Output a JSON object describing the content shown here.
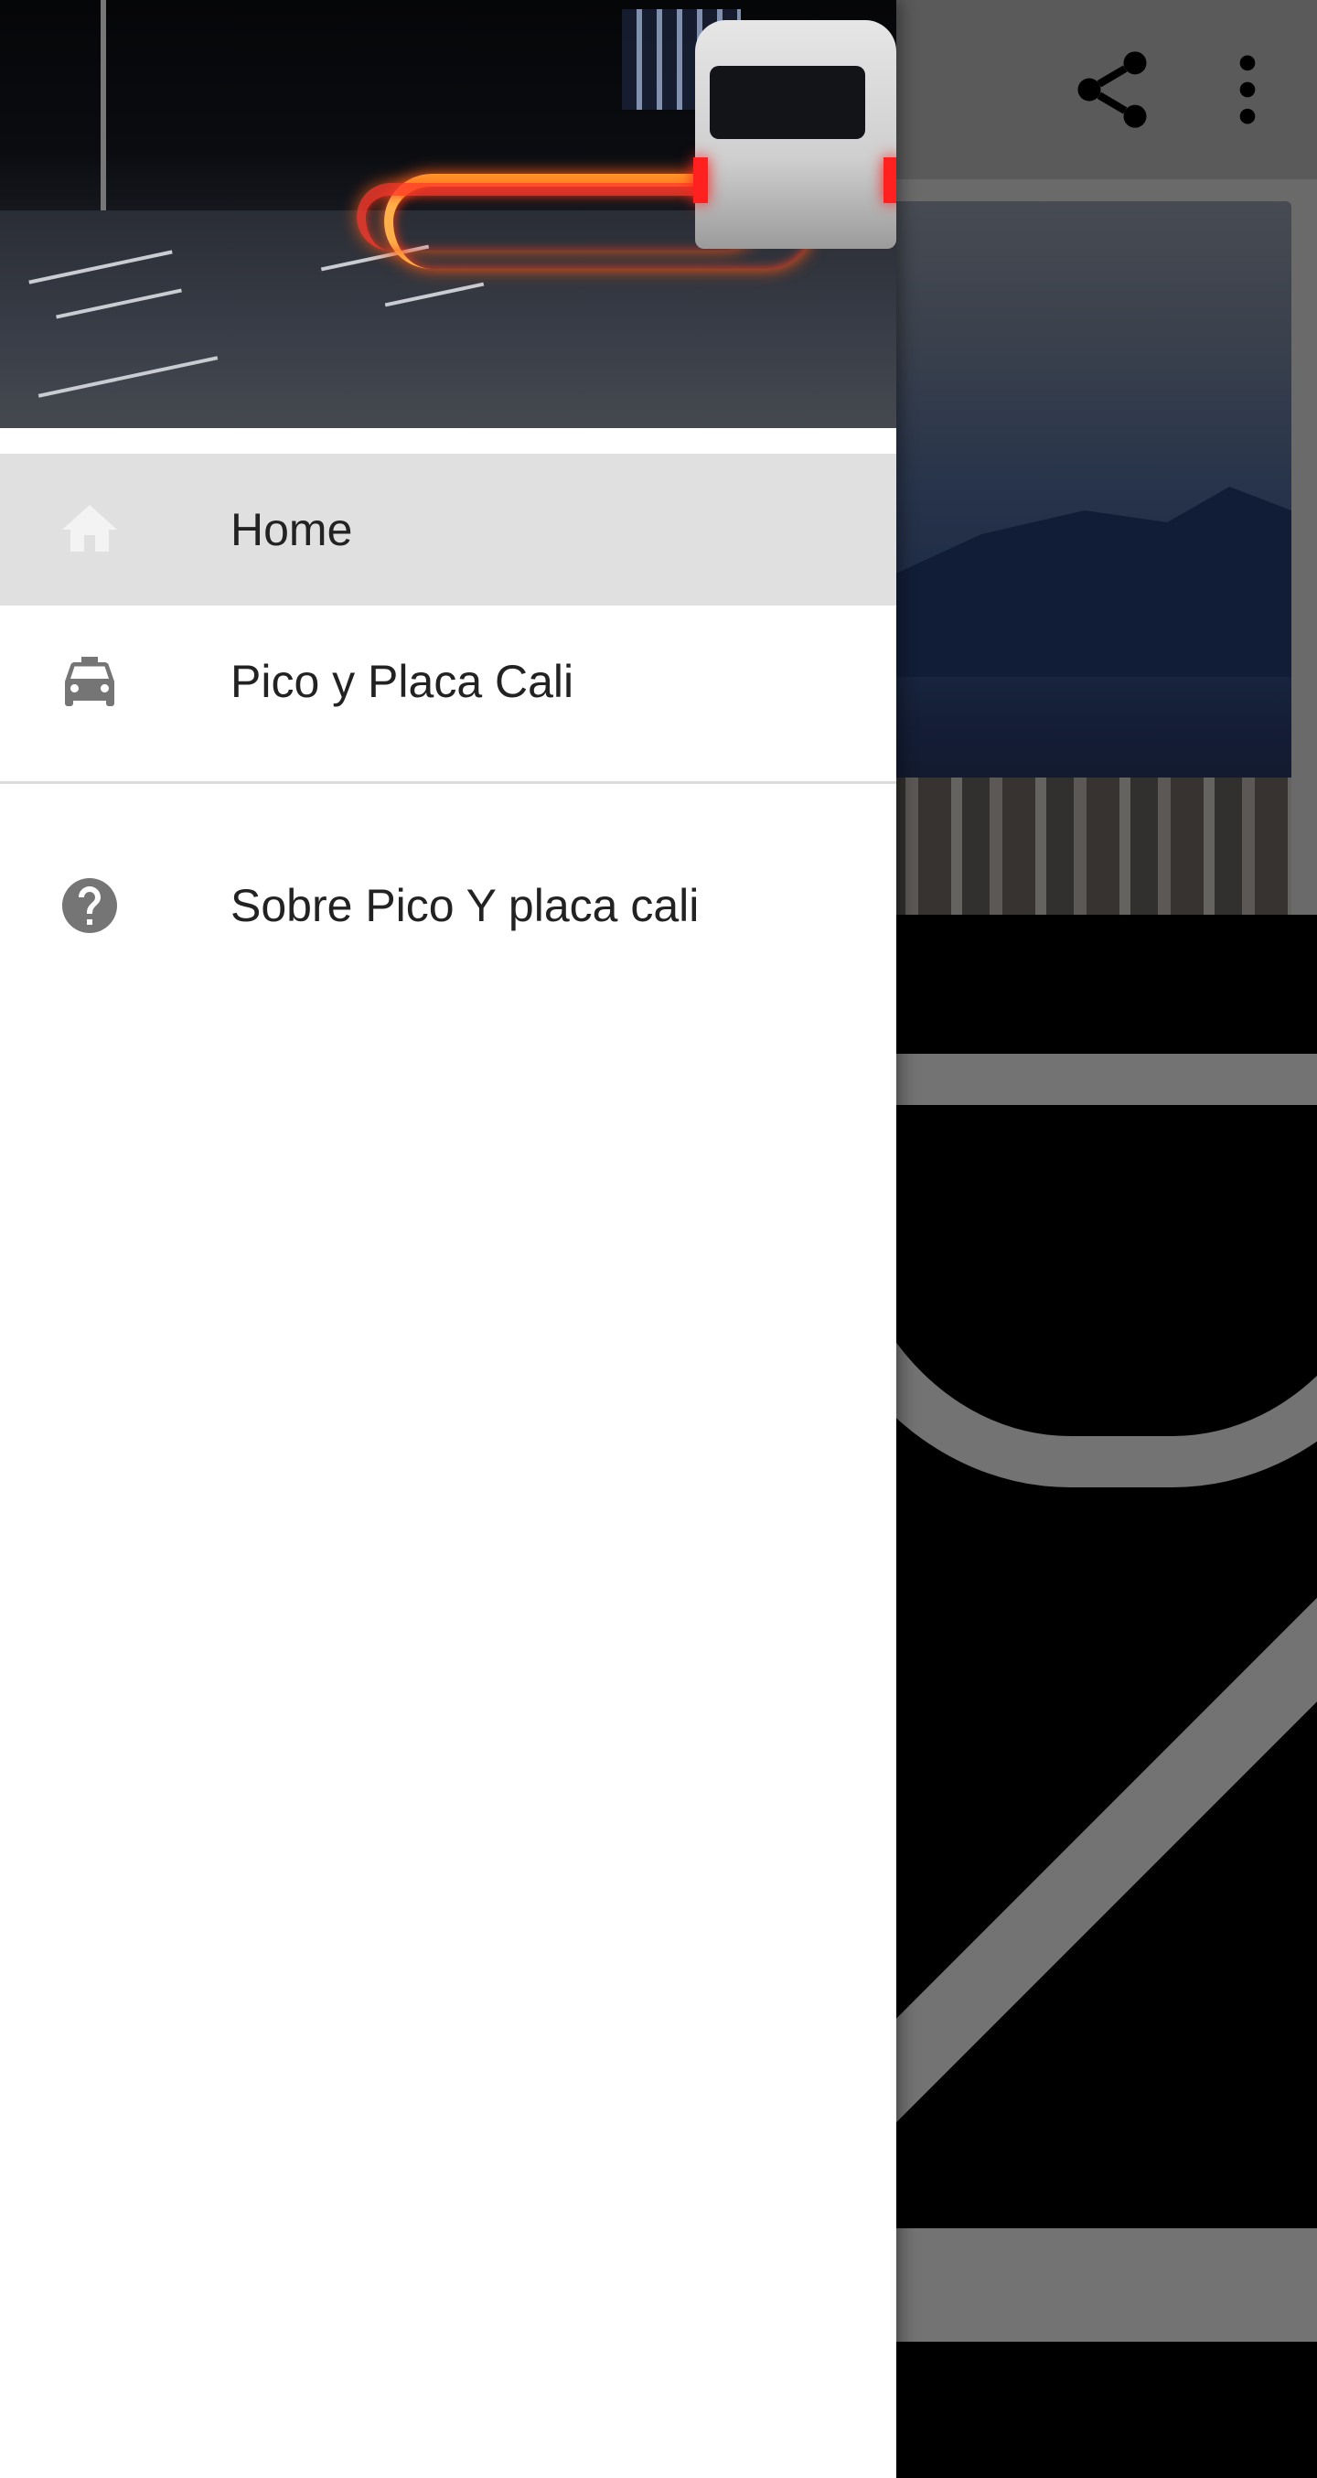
{
  "toolbar": {
    "share_icon": "share-icon",
    "more_icon": "more-vert-icon"
  },
  "drawer": {
    "header_image": "night-traffic-photo",
    "items": [
      {
        "label": "Home",
        "icon": "home-icon",
        "selected": true
      },
      {
        "label": "Pico y Placa Cali",
        "icon": "taxi-icon",
        "selected": false
      },
      {
        "label": "Sobre Pico Y placa cali",
        "icon": "help-circle-icon",
        "selected": false
      }
    ]
  },
  "colors": {
    "selected_bg": "#e0e0e0",
    "icon_gray": "#757575",
    "home_icon_faded": "#f3f3f3",
    "text": "#222222"
  }
}
